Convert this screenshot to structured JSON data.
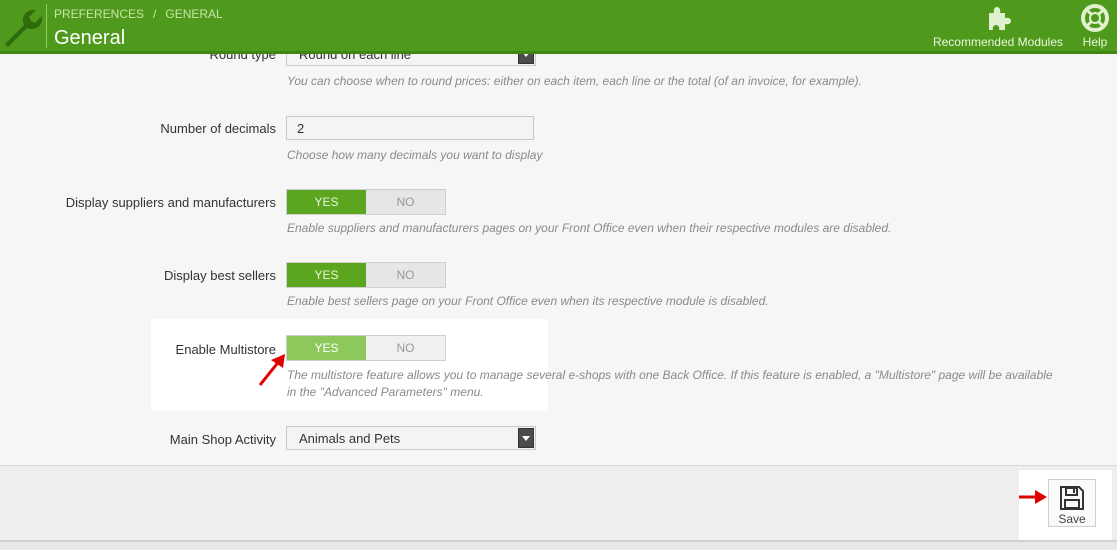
{
  "header": {
    "breadcrumb": [
      "PREFERENCES",
      "GENERAL"
    ],
    "title": "General",
    "toolbar": {
      "recommended_modules": "Recommended Modules",
      "help": "Help"
    },
    "accent_color": "#4f9a1c"
  },
  "form": {
    "round_type": {
      "label": "Round type",
      "value": "Round on each line",
      "help": "You can choose when to round prices: either on each item, each line or the total (of an invoice, for example)."
    },
    "decimals": {
      "label": "Number of decimals",
      "value": "2",
      "help": "Choose how many decimals you want to display"
    },
    "suppliers": {
      "label": "Display suppliers and manufacturers",
      "yes": "YES",
      "no": "NO",
      "selected": "YES",
      "help": "Enable suppliers and manufacturers pages on your Front Office even when their respective modules are disabled."
    },
    "best_sellers": {
      "label": "Display best sellers",
      "yes": "YES",
      "no": "NO",
      "selected": "YES",
      "help": "Enable best sellers page on your Front Office even when its respective module is disabled."
    },
    "multistore": {
      "label": "Enable Multistore",
      "yes": "YES",
      "no": "NO",
      "selected": "YES",
      "help_line1": "The multistore feature allows you to manage several e-shops with one Back Office. If this feature is enabled, a \"Multistore\" page will be available",
      "help_line2": "in the \"Advanced Parameters\" menu."
    },
    "activity": {
      "label": "Main Shop Activity",
      "value": "Animals and Pets"
    }
  },
  "footer": {
    "save_label": "Save"
  },
  "icons": {
    "logo": "wrench-icon",
    "recommended": "puzzle-icon",
    "help": "lifebuoy-icon",
    "save": "floppy-disk-icon",
    "annotation": "red-arrow-icon"
  }
}
